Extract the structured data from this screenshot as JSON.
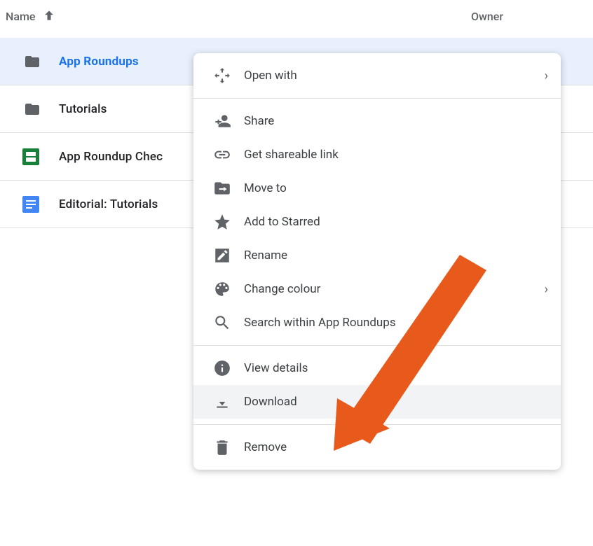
{
  "header": {
    "name_col": "Name",
    "owner_col": "Owner"
  },
  "files": [
    {
      "label": "App Roundups",
      "type": "folder",
      "selected": true
    },
    {
      "label": "Tutorials",
      "type": "folder",
      "selected": false
    },
    {
      "label": "App Roundup Chec",
      "type": "sheet",
      "selected": false
    },
    {
      "label": "Editorial: Tutorials",
      "type": "doc",
      "selected": false
    }
  ],
  "menu": {
    "open_with": "Open with",
    "share": "Share",
    "get_link": "Get shareable link",
    "move_to": "Move to",
    "add_starred": "Add to Starred",
    "rename": "Rename",
    "change_colour": "Change colour",
    "search_within": "Search within App Roundups",
    "view_details": "View details",
    "download": "Download",
    "remove": "Remove"
  }
}
